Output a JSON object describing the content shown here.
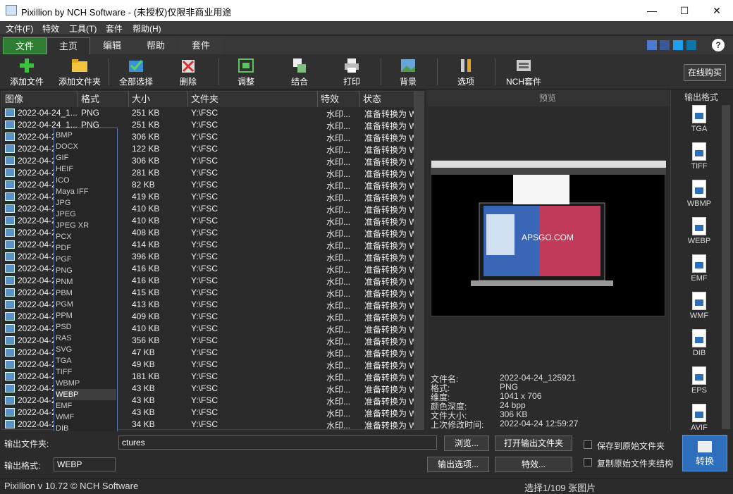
{
  "window": {
    "title": "Pixillion by NCH Software - (未授权)仅限非商业用途",
    "minimize": "—",
    "maximize": "☐",
    "close": "✕"
  },
  "menu": [
    "文件(F)",
    "特效",
    "工具(T)",
    "套件",
    "帮助(H)"
  ],
  "tabs": [
    "文件",
    "主页",
    "编辑",
    "帮助",
    "套件"
  ],
  "toolbar": {
    "add_file": "添加文件",
    "add_folder": "添加文件夹",
    "select_all": "全部选择",
    "delete": "删除",
    "adjust": "调整",
    "combine": "结合",
    "print": "打印",
    "background": "背景",
    "options": "选项",
    "nch_suite": "NCH套件",
    "buy_online": "在线购买"
  },
  "columns": [
    "图像",
    "格式",
    "大小",
    "文件夹",
    "特效",
    "状态"
  ],
  "rows": [
    [
      "2022-04-24_1...",
      "PNG",
      "251 KB",
      "Y:\\FSC",
      "水印...",
      "准备转换为 W"
    ],
    [
      "2022-04-24_1...",
      "PNG",
      "251 KB",
      "Y:\\FSC",
      "水印...",
      "准备转换为 W"
    ],
    [
      "2022-04-2",
      "",
      "306 KB",
      "Y:\\FSC",
      "水印...",
      "准备转换为 W"
    ],
    [
      "2022-04-2",
      "",
      "122 KB",
      "Y:\\FSC",
      "水印...",
      "准备转换为 W"
    ],
    [
      "2022-04-2",
      "",
      "306 KB",
      "Y:\\FSC",
      "水印...",
      "准备转换为 W"
    ],
    [
      "2022-04-2",
      "",
      "281 KB",
      "Y:\\FSC",
      "水印...",
      "准备转换为 W"
    ],
    [
      "2022-04-2",
      "",
      "82 KB",
      "Y:\\FSC",
      "水印...",
      "准备转换为 W"
    ],
    [
      "2022-04-2",
      "",
      "419 KB",
      "Y:\\FSC",
      "水印...",
      "准备转换为 W"
    ],
    [
      "2022-04-2",
      "",
      "410 KB",
      "Y:\\FSC",
      "水印...",
      "准备转换为 W"
    ],
    [
      "2022-04-2",
      "",
      "410 KB",
      "Y:\\FSC",
      "水印...",
      "准备转换为 W"
    ],
    [
      "2022-04-2",
      "",
      "408 KB",
      "Y:\\FSC",
      "水印...",
      "准备转换为 W"
    ],
    [
      "2022-04-2",
      "",
      "414 KB",
      "Y:\\FSC",
      "水印...",
      "准备转换为 W"
    ],
    [
      "2022-04-2",
      "",
      "396 KB",
      "Y:\\FSC",
      "水印...",
      "准备转换为 W"
    ],
    [
      "2022-04-2",
      "",
      "416 KB",
      "Y:\\FSC",
      "水印...",
      "准备转换为 W"
    ],
    [
      "2022-04-2",
      "",
      "416 KB",
      "Y:\\FSC",
      "水印...",
      "准备转换为 W"
    ],
    [
      "2022-04-2",
      "",
      "415 KB",
      "Y:\\FSC",
      "水印...",
      "准备转换为 W"
    ],
    [
      "2022-04-2",
      "",
      "413 KB",
      "Y:\\FSC",
      "水印...",
      "准备转换为 W"
    ],
    [
      "2022-04-2",
      "",
      "409 KB",
      "Y:\\FSC",
      "水印...",
      "准备转换为 W"
    ],
    [
      "2022-04-2",
      "",
      "410 KB",
      "Y:\\FSC",
      "水印...",
      "准备转换为 W"
    ],
    [
      "2022-04-2",
      "",
      "356 KB",
      "Y:\\FSC",
      "水印...",
      "准备转换为 W"
    ],
    [
      "2022-04-2",
      "",
      "47 KB",
      "Y:\\FSC",
      "水印...",
      "准备转换为 W"
    ],
    [
      "2022-04-2",
      "",
      "49 KB",
      "Y:\\FSC",
      "水印...",
      "准备转换为 W"
    ],
    [
      "2022-04-2",
      "",
      "181 KB",
      "Y:\\FSC",
      "水印...",
      "准备转换为 W"
    ],
    [
      "2022-04-2",
      "",
      "43 KB",
      "Y:\\FSC",
      "水印...",
      "准备转换为 W"
    ],
    [
      "2022-04-2",
      "",
      "43 KB",
      "Y:\\FSC",
      "水印...",
      "准备转换为 W"
    ],
    [
      "2022-04-2",
      "",
      "43 KB",
      "Y:\\FSC",
      "水印...",
      "准备转换为 W"
    ],
    [
      "2022-04-2",
      "",
      "34 KB",
      "Y:\\FSC",
      "水印...",
      "准备转换为 W"
    ]
  ],
  "format_options": [
    "BMP",
    "DOCX",
    "GIF",
    "HEIF",
    "ICO",
    "Maya IFF",
    "JPG",
    "JPEG",
    "JPEG XR",
    "PCX",
    "PDF",
    "PGF",
    "PNG",
    "PNM",
    "PBM",
    "PGM",
    "PPM",
    "PSD",
    "RAS",
    "SVG",
    "TGA",
    "TIFF",
    "WBMP",
    "WEBP",
    "EMF",
    "WMF",
    "DIB",
    "EPS",
    "AVIF"
  ],
  "preview": {
    "title": "预览",
    "watermark": "APSGO.COM",
    "info_labels": [
      "文件名:",
      "格式:",
      "维度:",
      "颜色深度:",
      "文件大小:",
      "上次修改时间:"
    ],
    "info_values": [
      "2022-04-24_125921",
      "PNG",
      "1041 x 706",
      "24 bpp",
      "306 KB",
      "2022-04-24 12:59:27"
    ]
  },
  "output_panel": {
    "title": "输出格式",
    "formats": [
      "TGA",
      "TIFF",
      "WBMP",
      "WEBP",
      "EMF",
      "WMF",
      "DIB",
      "EPS",
      "AVIF"
    ]
  },
  "bottom": {
    "output_folder_label": "输出文件夹:",
    "output_folder_value": "ctures",
    "browse": "浏览...",
    "open_output": "打开输出文件夹",
    "output_format_label": "输出格式:",
    "output_format_value": "WEBP",
    "output_options": "输出选项...",
    "effects": "特效...",
    "save_original": "保存到原始文件夹",
    "copy_structure": "复制原始文件夹结构",
    "convert": "转换"
  },
  "status": {
    "version": "Pixillion v 10.72 © NCH Software",
    "selection": "选择1/109 张图片"
  }
}
